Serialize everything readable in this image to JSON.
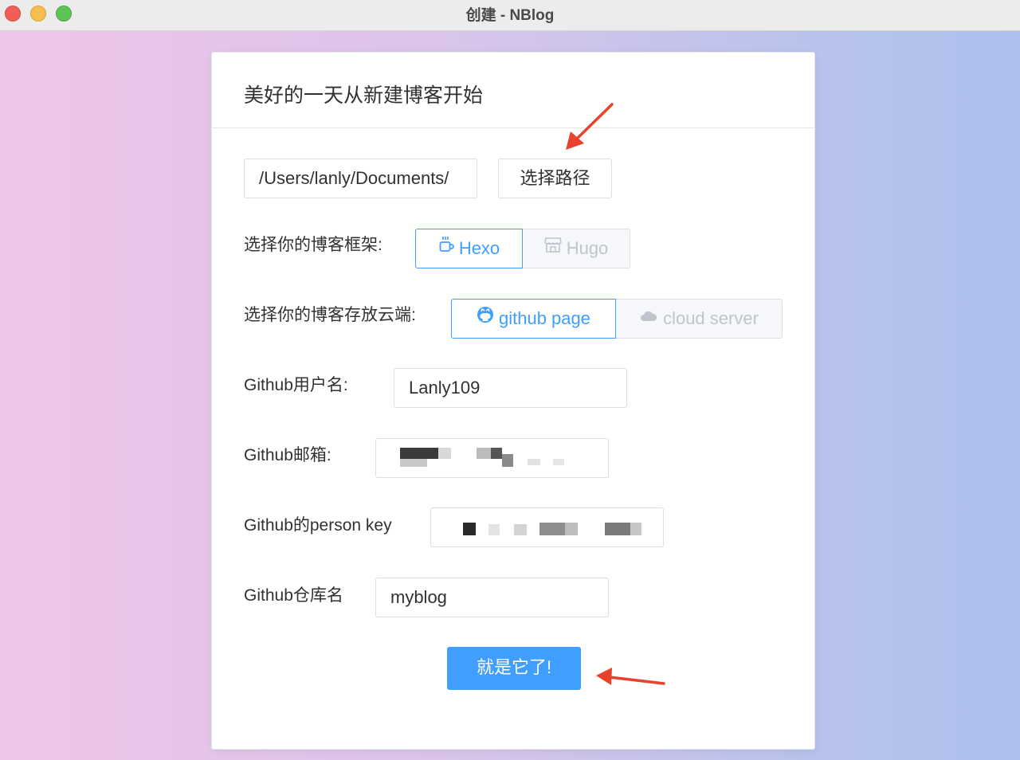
{
  "window": {
    "title": "创建 - NBlog"
  },
  "card": {
    "title": "美好的一天从新建博客开始"
  },
  "path": {
    "value": "/Users/lanly/Documents/",
    "button_label": "选择路径"
  },
  "framework": {
    "label": "选择你的博客框架:",
    "options": [
      {
        "label": "Hexo",
        "icon": "coffee-cup-icon",
        "selected": true
      },
      {
        "label": "Hugo",
        "icon": "store-icon",
        "selected": false
      }
    ]
  },
  "cloud": {
    "label": "选择你的博客存放云端:",
    "options": [
      {
        "label": "github page",
        "icon": "github-icon",
        "selected": true
      },
      {
        "label": "cloud server",
        "icon": "cloud-icon",
        "selected": false
      }
    ]
  },
  "username": {
    "label": "Github用户名:",
    "value": "Lanly109"
  },
  "email": {
    "label": "Github邮箱:"
  },
  "person_key": {
    "label": "Github的person key"
  },
  "repo": {
    "label": "Github仓库名",
    "value": "myblog"
  },
  "submit": {
    "label": "就是它了!"
  },
  "colors": {
    "primary": "#409eff",
    "annotation_arrow": "#e8412c"
  }
}
